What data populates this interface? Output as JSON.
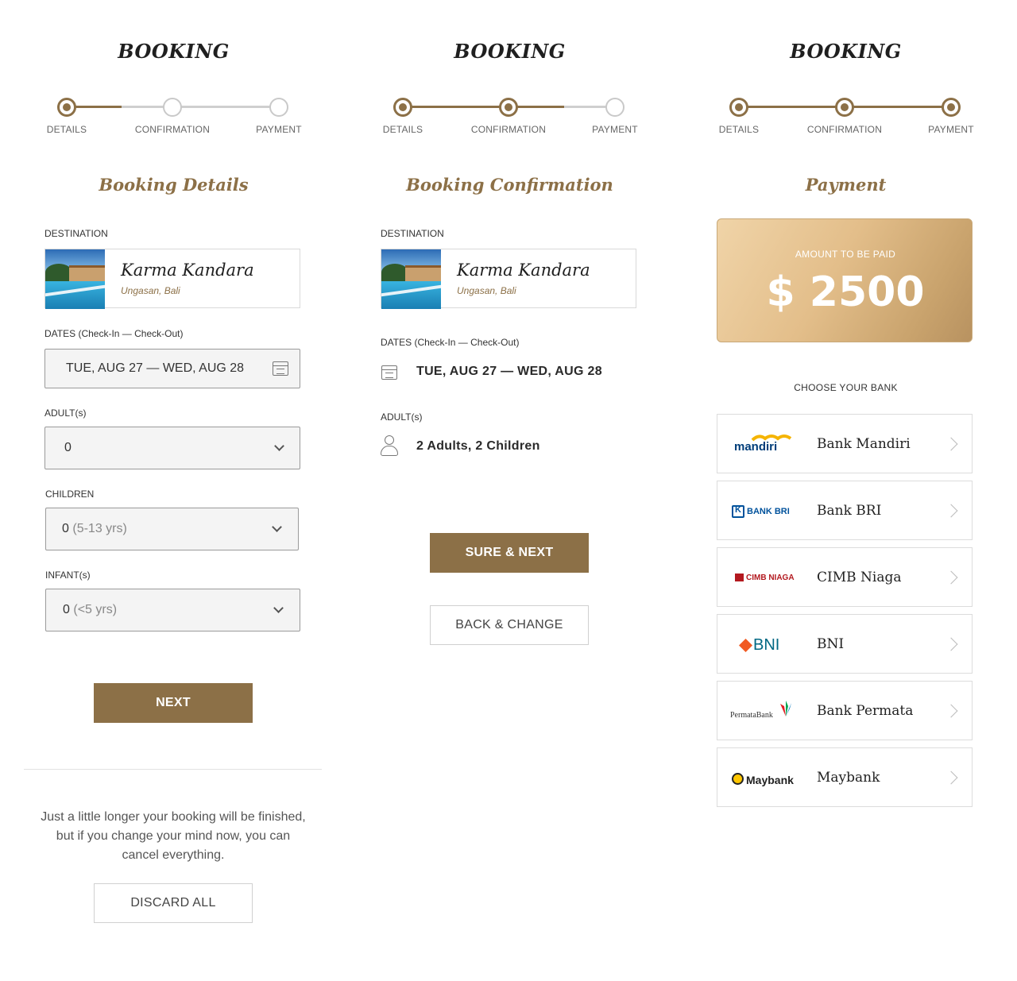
{
  "panels": {
    "details": {
      "title": "BOOKING",
      "steps": [
        "DETAILS",
        "CONFIRMATION",
        "PAYMENT"
      ],
      "section_title": "Booking Details",
      "destination_label": "DESTINATION",
      "destination_name": "Karma Kandara",
      "destination_location": "Ungasan, Bali",
      "dates_label": "DATES (Check-In — Check-Out)",
      "dates_value": "TUE, AUG 27 — WED, AUG 28",
      "adults_label": "ADULT(s)",
      "adults_value": "0",
      "children_label": "CHILDREN",
      "children_value": "0",
      "children_hint": "(5-13 yrs)",
      "infants_label": "INFANT(s)",
      "infants_value": "0",
      "infants_hint": "(<5 yrs)",
      "next_label": "NEXT",
      "note": "Just a little longer your booking will be finished, but if you change your mind now, you can cancel everything.",
      "discard_label": "DISCARD  ALL"
    },
    "confirmation": {
      "title": "BOOKING",
      "steps": [
        "DETAILS",
        "CONFIRMATION",
        "PAYMENT"
      ],
      "section_title": "Booking Confirmation",
      "destination_label": "DESTINATION",
      "destination_name": "Karma Kandara",
      "destination_location": "Ungasan, Bali",
      "dates_label": "DATES (Check-In — Check-Out)",
      "dates_value": "TUE, AUG 27 — WED, AUG 28",
      "adults_label": "ADULT(s)",
      "guests_value": "2 Adults, 2 Children",
      "sure_label": "SURE & NEXT",
      "back_label": "BACK & CHANGE"
    },
    "payment": {
      "title": "BOOKING",
      "steps": [
        "DETAILS",
        "CONFIRMATION",
        "PAYMENT"
      ],
      "section_title": "Payment",
      "amount_label": "AMOUNT TO BE PAID",
      "amount_value": "$ 2500",
      "choose_bank_label": "CHOOSE YOUR BANK",
      "banks": [
        {
          "name": "Bank Mandiri",
          "logo_text": "mandiri",
          "logo": "mandiri-logo"
        },
        {
          "name": "Bank BRI",
          "logo_text": "BANK BRI",
          "logo": "bri-logo"
        },
        {
          "name": "CIMB Niaga",
          "logo_text": "CIMB NIAGA",
          "logo": "cimb-logo"
        },
        {
          "name": "BNI",
          "logo_text": "BNI",
          "logo": "bni-logo"
        },
        {
          "name": "Bank Permata",
          "logo_text": "PermataBank",
          "logo": "permata-logo"
        },
        {
          "name": "Maybank",
          "logo_text": "Maybank",
          "logo": "maybank-logo"
        }
      ]
    }
  },
  "colors": {
    "accent": "#8c7047",
    "track_inactive": "#cfcfcf",
    "gold_card_light": "#f0d4a8",
    "gold_card_dark": "#b89260"
  },
  "steps_progress": {
    "details": 1,
    "confirmation": 2,
    "payment": 3
  }
}
